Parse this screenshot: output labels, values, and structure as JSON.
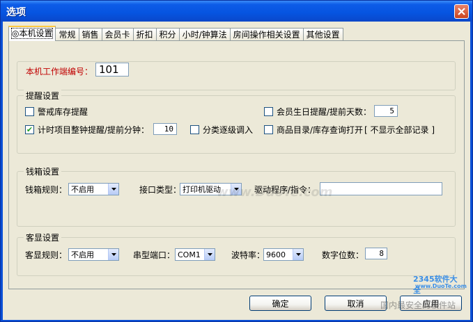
{
  "window": {
    "title": "选项"
  },
  "tabs": [
    {
      "label": "◎本机设置",
      "active": true
    },
    {
      "label": "常规"
    },
    {
      "label": "销售"
    },
    {
      "label": "会员卡"
    },
    {
      "label": "折扣"
    },
    {
      "label": "积分"
    },
    {
      "label": "小时/钟算法"
    },
    {
      "label": "房间操作相关设置"
    },
    {
      "label": "其他设置"
    }
  ],
  "terminal": {
    "label": "本机工作端编号：",
    "value": "101"
  },
  "reminder": {
    "title": "提醒设置",
    "stock_alert": {
      "label": "警戒库存提醒",
      "checked": false
    },
    "member_birthday": {
      "label": "会员生日提醒/提前天数：",
      "checked": false,
      "value": "5"
    },
    "timer_alert": {
      "label": "计时项目整钟提醒/提前分钟：",
      "checked": true,
      "value": "10"
    },
    "category_step": {
      "label": "分类逐级调入",
      "checked": false
    },
    "catalog_open": {
      "label": "商品目录/库存查询打开",
      "checked": false,
      "note": "[ 不显示全部记录 ]"
    }
  },
  "cashbox": {
    "title": "钱箱设置",
    "rule_label": "钱箱规则：",
    "rule_value": "不启用",
    "port_type_label": "接口类型：",
    "port_type_value": "打印机驱动",
    "driver_label": "驱动程序/指令：",
    "driver_value": ""
  },
  "display": {
    "title": "客显设置",
    "rule_label": "客显规则：",
    "rule_value": "不启用",
    "port_label": "串型端口：",
    "port_value": "COM1",
    "baud_label": "波特率：",
    "baud_value": "9600",
    "digits_label": "数字位数：",
    "digits_value": "8"
  },
  "buttons": {
    "ok": "确定",
    "cancel": "取消",
    "apply": "应用"
  },
  "watermark": {
    "text": "www.DuoTe.com",
    "logo": "2345软件大全",
    "logo_url": "www.DuoTe.com",
    "sub": "国内最安全的软件站"
  },
  "colors": {
    "titlebar": "#0654e0",
    "dialog_bg": "#ece9d8",
    "red_label": "#c00000"
  }
}
